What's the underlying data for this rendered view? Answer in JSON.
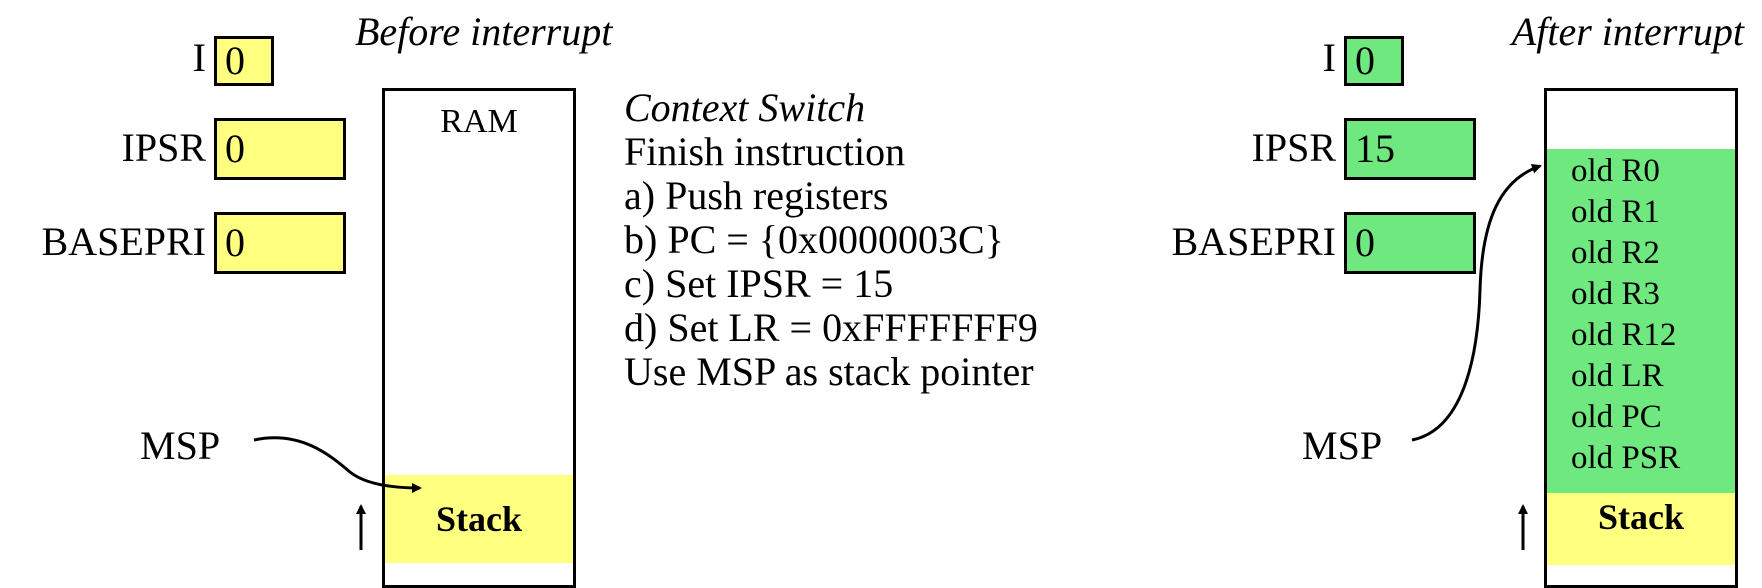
{
  "colors": {
    "before_fill": "#ffff80",
    "after_fill": "#6ee87f",
    "stack_fill": "#ffff80",
    "line": "#000000"
  },
  "before": {
    "title": "Before interrupt",
    "registers": {
      "i": {
        "label": "I",
        "value": "0"
      },
      "ipsr": {
        "label": "IPSR",
        "value": "0"
      },
      "basepri": {
        "label": "BASEPRI",
        "value": "0"
      }
    },
    "memory": {
      "label": "RAM",
      "stack_label": "Stack",
      "pointer_label": "MSP"
    }
  },
  "context_switch": {
    "title": "Context Switch",
    "steps": [
      "Finish instruction",
      "a) Push registers",
      "b) PC = {0x0000003C}",
      "c) Set IPSR = 15",
      "d) Set LR = 0xFFFFFFF9",
      "Use MSP as stack pointer"
    ]
  },
  "after": {
    "title": "After interrupt",
    "registers": {
      "i": {
        "label": "I",
        "value": "0"
      },
      "ipsr": {
        "label": "IPSR",
        "value": "15"
      },
      "basepri": {
        "label": "BASEPRI",
        "value": "0"
      }
    },
    "memory": {
      "saved_registers": [
        "old R0",
        "old R1",
        "old R2",
        "old R3",
        "old R12",
        "old LR",
        "old PC",
        "old PSR"
      ],
      "stack_label": "Stack",
      "pointer_label": "MSP"
    }
  }
}
